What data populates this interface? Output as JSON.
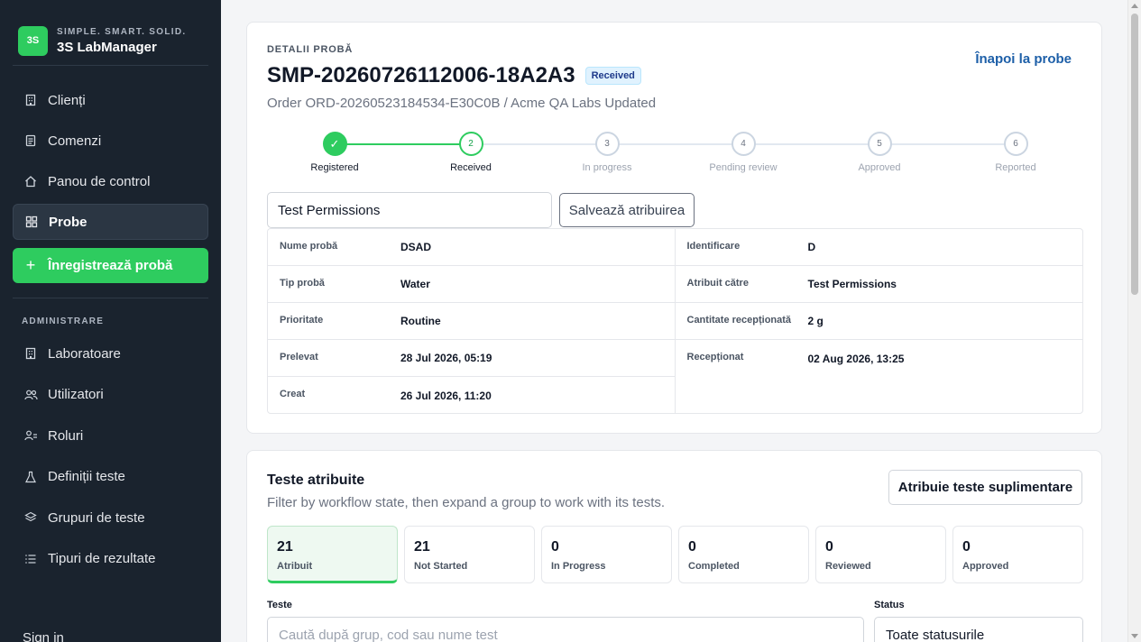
{
  "brand": {
    "logo_text": "3S",
    "tagline": "SIMPLE. SMART. SOLID.",
    "name": "3S LabManager"
  },
  "sidebar": {
    "items": [
      {
        "label": "Clienți",
        "icon": "building-icon"
      },
      {
        "label": "Comenzi",
        "icon": "document-icon"
      },
      {
        "label": "Panou de control",
        "icon": "home-icon"
      },
      {
        "label": "Probe",
        "icon": "grid-icon",
        "active": true
      }
    ],
    "cta_label": "Înregistrează probă",
    "admin_section": "ADMINISTRARE",
    "admin_items": [
      {
        "label": "Laboratoare",
        "icon": "building-icon"
      },
      {
        "label": "Utilizatori",
        "icon": "users-icon"
      },
      {
        "label": "Roluri",
        "icon": "roles-icon"
      },
      {
        "label": "Definiții teste",
        "icon": "flask-icon"
      },
      {
        "label": "Grupuri de teste",
        "icon": "layers-icon"
      },
      {
        "label": "Tipuri de rezultate",
        "icon": "list-icon"
      }
    ],
    "signin": "Sign in"
  },
  "sample": {
    "eyebrow": "DETALII PROBĂ",
    "id": "SMP-20260726112006-18A2A3",
    "status_badge": "Received",
    "subtitle": "Order ORD-20260523184534-E30C0B / Acme QA Labs Updated",
    "back_link": "Înapoi la probe",
    "steps": [
      {
        "marker": "✓",
        "label": "Registered"
      },
      {
        "marker": "2",
        "label": "Received"
      },
      {
        "marker": "3",
        "label": "In progress"
      },
      {
        "marker": "4",
        "label": "Pending review"
      },
      {
        "marker": "5",
        "label": "Approved"
      },
      {
        "marker": "6",
        "label": "Reported"
      }
    ],
    "assign_value": "Test Permissions",
    "assign_button": "Salvează atribuirea",
    "details_left": [
      {
        "key": "Nume probă",
        "value": "DSAD"
      },
      {
        "key": "Tip probă",
        "value": "Water"
      },
      {
        "key": "Prioritate",
        "value": "Routine"
      },
      {
        "key": "Prelevat",
        "value": "28 Jul 2026, 05:19"
      },
      {
        "key": "Creat",
        "value": "26 Jul 2026, 11:20"
      }
    ],
    "details_right": [
      {
        "key": "Identificare",
        "value": "D"
      },
      {
        "key": "Atribuit către",
        "value": "Test Permissions"
      },
      {
        "key": "Cantitate recepționată",
        "value": "2 g"
      },
      {
        "key": "Recepționat",
        "value": "02 Aug 2026, 13:25"
      }
    ]
  },
  "tests": {
    "title": "Teste atribuite",
    "subtitle": "Filter by workflow state, then expand a group to work with its tests.",
    "extra_button": "Atribuie teste suplimentare",
    "stats": [
      {
        "value": "21",
        "label": "Atribuit"
      },
      {
        "value": "21",
        "label": "Not Started"
      },
      {
        "value": "0",
        "label": "In Progress"
      },
      {
        "value": "0",
        "label": "Completed"
      },
      {
        "value": "0",
        "label": "Reviewed"
      },
      {
        "value": "0",
        "label": "Approved"
      }
    ],
    "search_label": "Teste",
    "search_placeholder": "Caută după grup, cod sau nume test",
    "status_label": "Status",
    "status_value": "Toate statusurile"
  },
  "colors": {
    "accent": "#2ecc5f",
    "sidebar_bg": "#1a232e",
    "link": "#1d5fa8"
  }
}
